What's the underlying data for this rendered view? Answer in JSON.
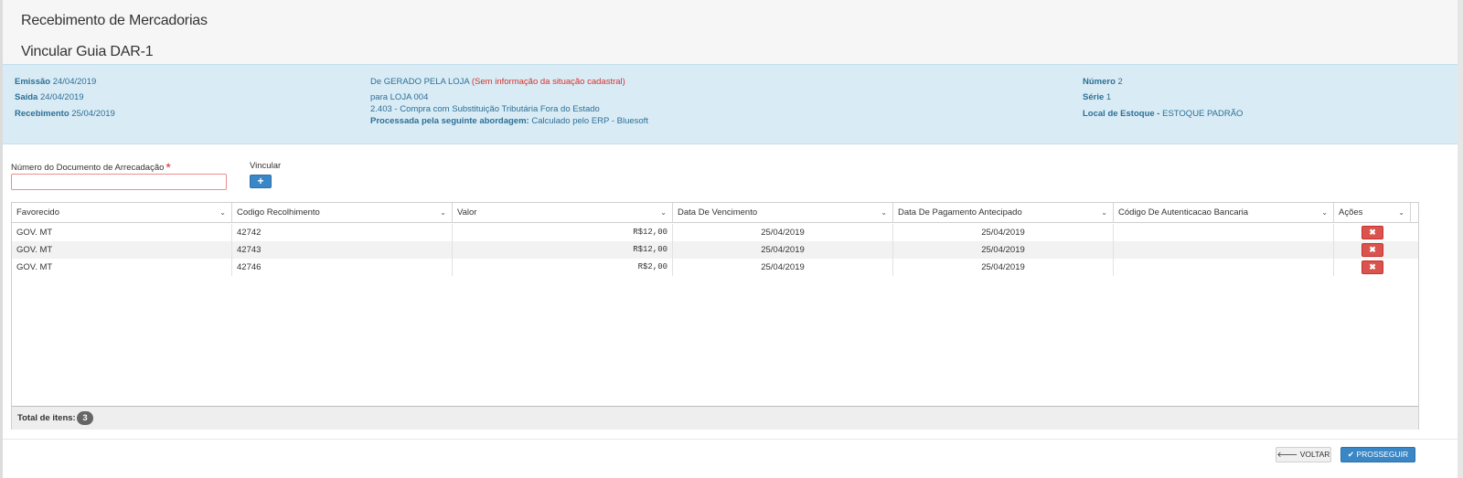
{
  "header": {
    "title": "Recebimento de Mercadorias",
    "subtitle": "Vincular Guia DAR-1"
  },
  "info": {
    "emissao_label": "Emissão",
    "emissao_value": "24/04/2019",
    "saida_label": "Saída",
    "saida_value": "24/04/2019",
    "recebimento_label": "Recebimento",
    "recebimento_value": "25/04/2019",
    "de_text": "De GERADO PELA LOJA",
    "situacao_text": "(Sem informação da situação cadastral)",
    "para_text": "para LOJA 004",
    "cfop_text": "2.403 - Compra com Substituição Tributária Fora do Estado",
    "abordagem_label": "Processada pela seguinte abordagem:",
    "abordagem_value": "Calculado pelo ERP - Bluesoft",
    "numero_label": "Número",
    "numero_value": "2",
    "serie_label": "Série",
    "serie_value": "1",
    "local_label": "Local de Estoque -",
    "local_value": "ESTOQUE PADRÃO"
  },
  "form": {
    "doc_label": "Número do Documento de Arrecadação",
    "doc_required": "*",
    "doc_value": "",
    "vincular_label": "Vincular",
    "add_icon": "+"
  },
  "table": {
    "columns": [
      "Favorecido",
      "Codigo Recolhimento",
      "Valor",
      "Data De Vencimento",
      "Data De Pagamento Antecipado",
      "Código De Autenticacao Bancaria",
      "Ações"
    ],
    "rows": [
      {
        "favorecido": "GOV. MT",
        "codigo": "42742",
        "valor": "R$12,00",
        "vencimento": "25/04/2019",
        "pagamento": "25/04/2019",
        "autenticacao": ""
      },
      {
        "favorecido": "GOV. MT",
        "codigo": "42743",
        "valor": "R$12,00",
        "vencimento": "25/04/2019",
        "pagamento": "25/04/2019",
        "autenticacao": ""
      },
      {
        "favorecido": "GOV. MT",
        "codigo": "42746",
        "valor": "R$2,00",
        "vencimento": "25/04/2019",
        "pagamento": "25/04/2019",
        "autenticacao": ""
      }
    ],
    "delete_icon": "✖",
    "total_label": "Total de itens:",
    "total_value": "3"
  },
  "footer": {
    "voltar_label": "VOLTAR",
    "voltar_icon": "🡐",
    "prosseguir_label": "PROSSEGUIR",
    "prosseguir_icon": "✔"
  },
  "colors": {
    "primary": "#3a87c8",
    "danger": "#d9534f",
    "info_bg": "#d9ecf6",
    "info_text": "#2d6f95"
  }
}
